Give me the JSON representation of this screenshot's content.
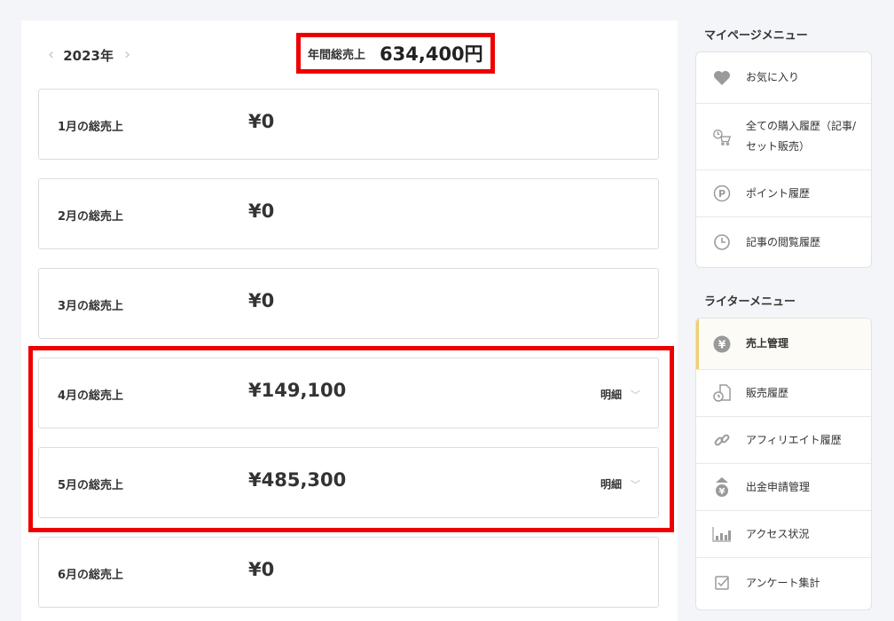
{
  "year_nav": {
    "prev_icon": "chevron-left-icon",
    "year": "2023年",
    "next_icon": "chevron-right-icon"
  },
  "annual": {
    "label": "年間総売上",
    "value": "634,400円"
  },
  "months": [
    {
      "label": "1月の総売上",
      "amount": "¥0"
    },
    {
      "label": "2月の総売上",
      "amount": "¥0"
    },
    {
      "label": "3月の総売上",
      "amount": "¥0"
    },
    {
      "label": "4月の総売上",
      "amount": "¥149,100",
      "detail": "明細"
    },
    {
      "label": "5月の総売上",
      "amount": "¥485,300",
      "detail": "明細"
    },
    {
      "label": "6月の総売上",
      "amount": "¥0"
    }
  ],
  "mypage_menu": {
    "title": "マイページメニュー",
    "items": [
      {
        "label": "お気に入り",
        "icon": "heart-icon"
      },
      {
        "label": "全ての購入履歴（記事/セット販売）",
        "icon": "cart-history-icon"
      },
      {
        "label": "ポイント履歴",
        "icon": "point-icon"
      },
      {
        "label": "記事の閲覧履歴",
        "icon": "clock-icon"
      }
    ]
  },
  "writer_menu": {
    "title": "ライターメニュー",
    "items": [
      {
        "label": "売上管理",
        "icon": "yen-icon",
        "active": true
      },
      {
        "label": "販売履歴",
        "icon": "document-clock-icon"
      },
      {
        "label": "アフィリエイト履歴",
        "icon": "link-icon"
      },
      {
        "label": "出金申請管理",
        "icon": "withdraw-icon"
      },
      {
        "label": "アクセス状況",
        "icon": "bar-chart-icon"
      },
      {
        "label": "アンケート集計",
        "icon": "checkbox-icon"
      }
    ]
  },
  "colors": {
    "highlight": "#ee0000",
    "active_accent": "#f2cf6b",
    "icon": "#9a9a9a"
  }
}
